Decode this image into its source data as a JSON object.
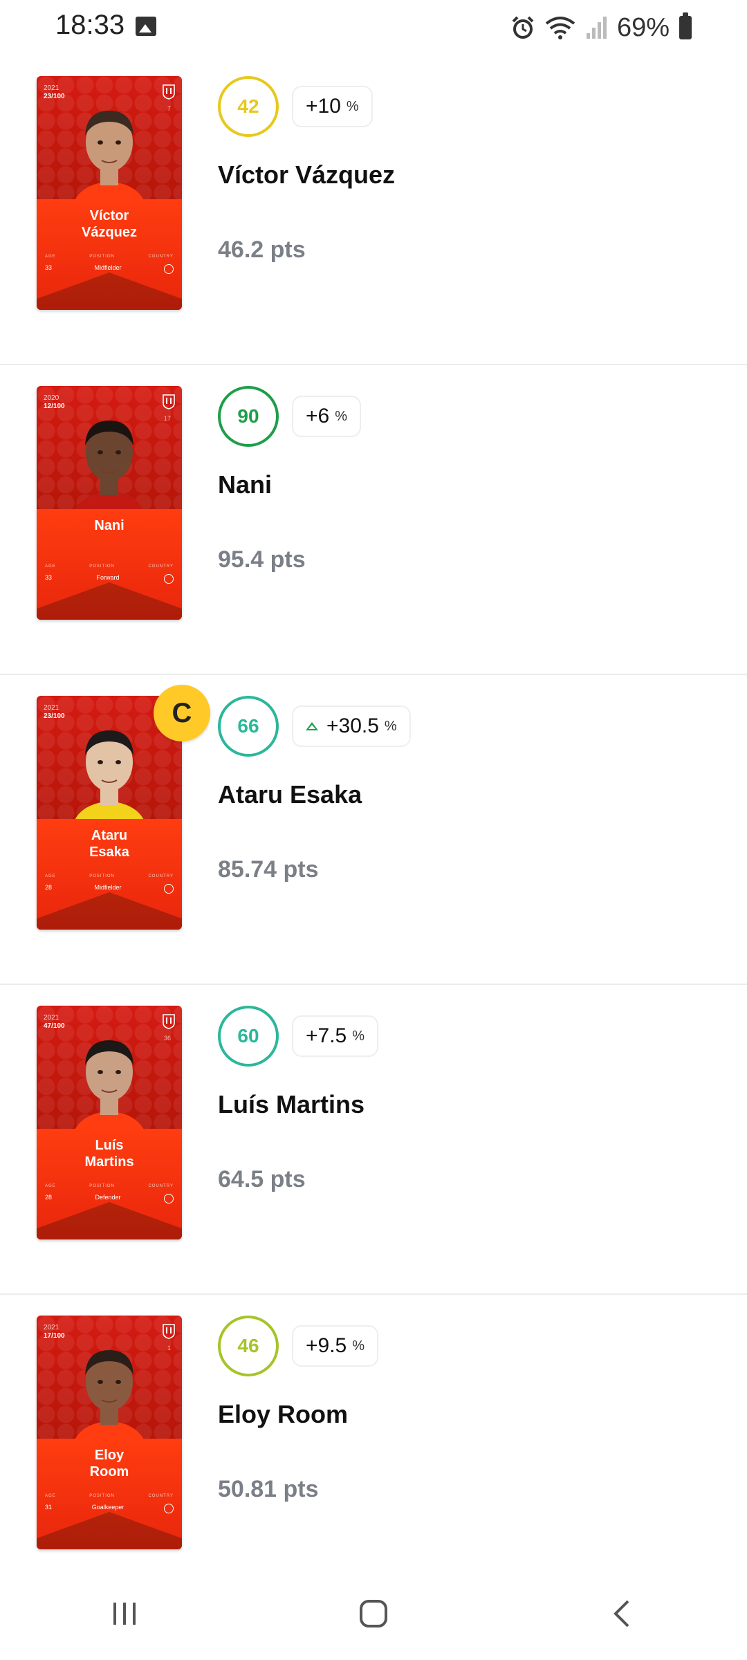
{
  "status_bar": {
    "time": "18:33",
    "battery_percent": "69%"
  },
  "players": [
    {
      "card": {
        "year": "2021",
        "serial": "23/100",
        "number": "7",
        "name": "Víctor\nVázquez",
        "age": "33",
        "position": "Midfielder",
        "labels": [
          "AGE",
          "POSITION",
          "COUNTRY"
        ]
      },
      "score": "42",
      "score_color": "#e8c81a",
      "bonus": "+10",
      "bonus_trend": "",
      "name": "Víctor Vázquez",
      "points": "46.2 pts",
      "captain": ""
    },
    {
      "card": {
        "year": "2020",
        "serial": "12/100",
        "number": "17",
        "name": "Nani",
        "age": "33",
        "position": "Forward",
        "labels": [
          "AGE",
          "POSITION",
          "COUNTRY"
        ]
      },
      "score": "90",
      "score_color": "#1e9e4a",
      "bonus": "+6",
      "bonus_trend": "",
      "name": "Nani",
      "points": "95.4 pts",
      "captain": ""
    },
    {
      "card": {
        "year": "2021",
        "serial": "23/100",
        "number": "10",
        "name": "Ataru\nEsaka",
        "age": "28",
        "position": "Midfielder",
        "labels": [
          "AGE",
          "POSITION",
          "COUNTRY"
        ]
      },
      "score": "66",
      "score_color": "#2bb79a",
      "bonus": "+30.5",
      "bonus_trend": "up",
      "name": "Ataru Esaka",
      "points": "85.74 pts",
      "captain": "C"
    },
    {
      "card": {
        "year": "2021",
        "serial": "47/100",
        "number": "36",
        "name": "Luís\nMartins",
        "age": "28",
        "position": "Defender",
        "labels": [
          "AGE",
          "POSITION",
          "COUNTRY"
        ]
      },
      "score": "60",
      "score_color": "#2bb79a",
      "bonus": "+7.5",
      "bonus_trend": "",
      "name": "Luís Martins",
      "points": "64.5 pts",
      "captain": ""
    },
    {
      "card": {
        "year": "2021",
        "serial": "17/100",
        "number": "1",
        "name": "Eloy\nRoom",
        "age": "31",
        "position": "Goalkeeper",
        "labels": [
          "AGE",
          "POSITION",
          "COUNTRY"
        ]
      },
      "score": "46",
      "score_color": "#a6c42a",
      "bonus": "+9.5",
      "bonus_trend": "",
      "name": "Eloy Room",
      "points": "50.81 pts",
      "captain": ""
    }
  ],
  "icons": {
    "status_left": "image-icon",
    "status_right": [
      "alarm-icon",
      "wifi-icon",
      "signal-icon",
      "battery-icon"
    ],
    "nav": [
      "recent-apps-icon",
      "home-icon",
      "back-icon"
    ]
  }
}
